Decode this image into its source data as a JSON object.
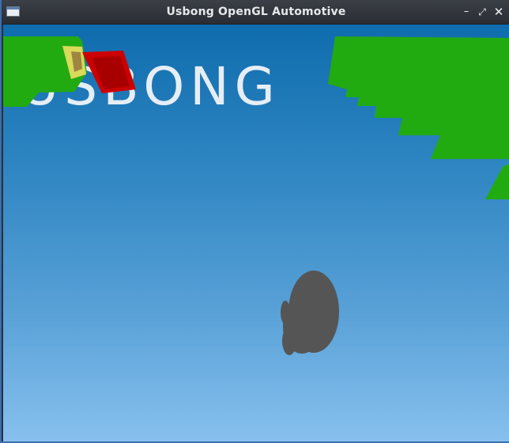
{
  "window": {
    "title": "Usbong OpenGL Automotive",
    "controls": {
      "minimize_icon": "minimize-icon",
      "maximize_icon": "maximize-icon",
      "close_icon": "close-icon"
    }
  },
  "scene": {
    "banner_text": "USBONG",
    "colors": {
      "sky_top": "#0f6cad",
      "sky_bottom": "#87c0ee",
      "foliage": "#22aa11",
      "sign_red": "#cc0000",
      "blob_gray": "#555555",
      "banner_text": "#e6eef5"
    }
  }
}
